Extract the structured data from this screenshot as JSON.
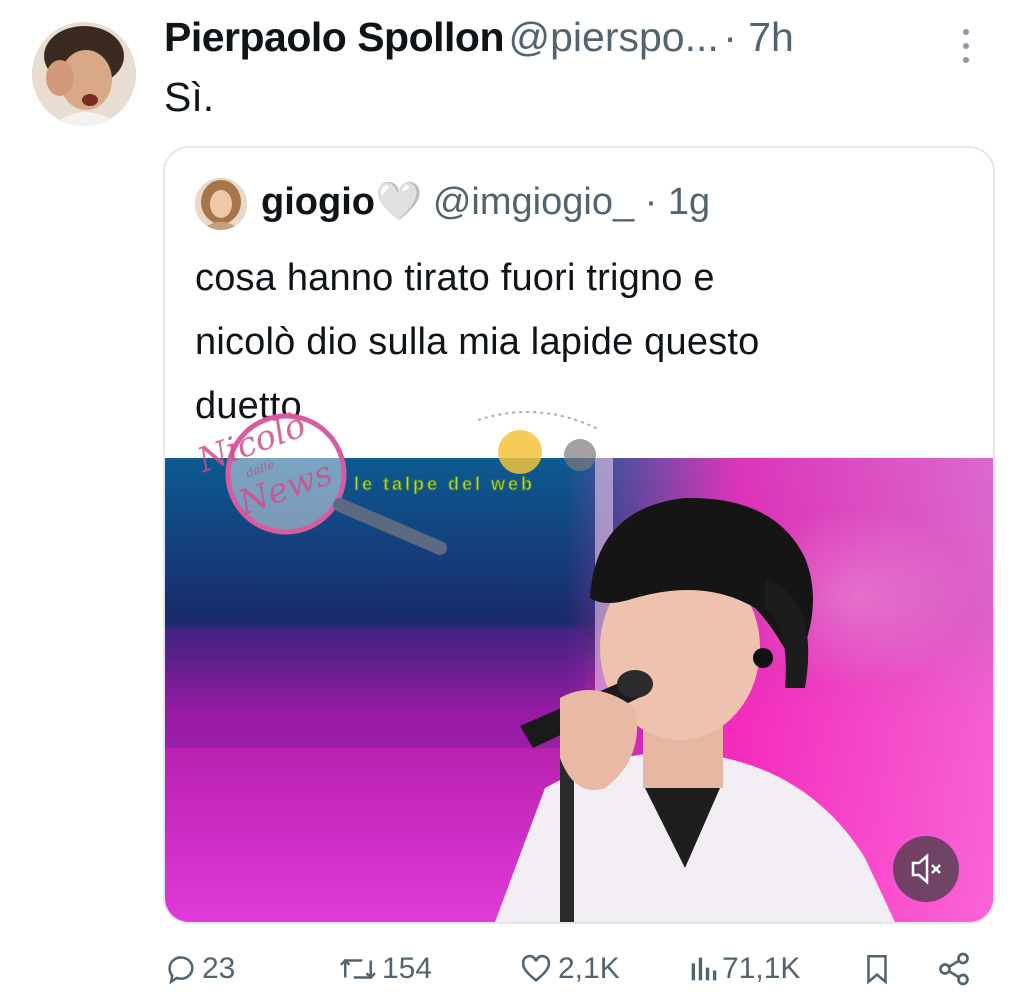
{
  "tweet": {
    "author_name": "Pierpaolo Spollon",
    "author_handle": "@pierspo...",
    "time": "· 7h",
    "text": "Sì."
  },
  "quoted_tweet": {
    "author_name": "giogio",
    "heart_emoji": "🤍",
    "author_handle": "@imgiogio_",
    "time": "· 1g",
    "lines": [
      "cosa hanno tirato fuori trigno e",
      "nicolò dio sulla mia lapide questo",
      "duetto"
    ]
  },
  "watermark": {
    "left_logo": [
      "Nicolò",
      "dalle",
      "News"
    ],
    "right_logo": "le talpe del web"
  },
  "actions": {
    "replies": "23",
    "reposts": "154",
    "likes": "2,1K",
    "views": "71,1K"
  },
  "icons": [
    "more-icon",
    "reply-icon",
    "repost-icon",
    "like-icon",
    "views-icon",
    "bookmark-icon",
    "share-icon",
    "mute-icon"
  ],
  "colors": {
    "text": "#0f1419",
    "secondary": "#536471",
    "border": "#e2e7ea",
    "stage_magenta": "#d21ec8",
    "stage_blue": "#1b6fd0"
  }
}
